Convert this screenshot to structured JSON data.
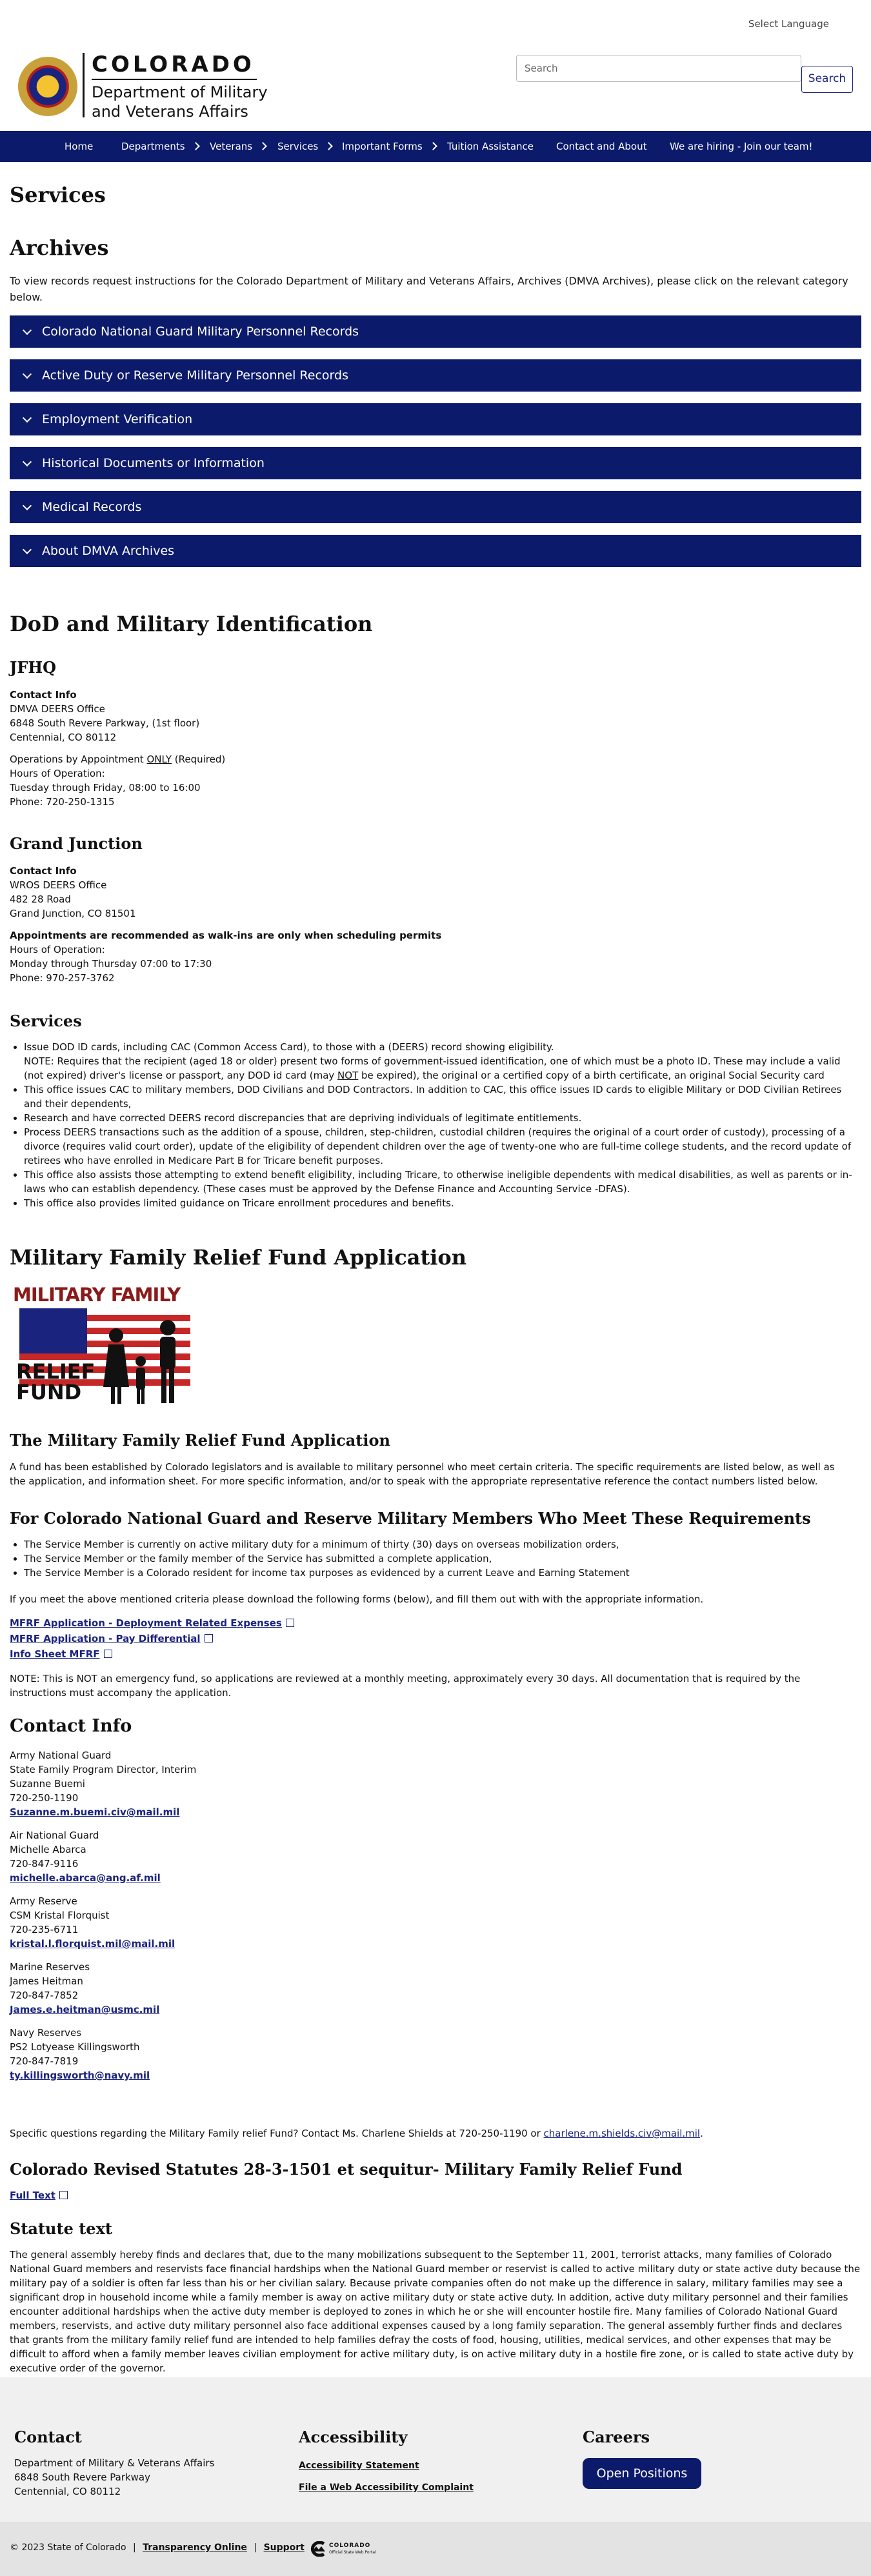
{
  "topbar": {
    "language": "Select Language"
  },
  "header": {
    "brand_line1": "COLORADO",
    "brand_line2": "Department of Military",
    "brand_line3": "and Veterans Affairs",
    "search_placeholder": "Search",
    "search_button": "Search"
  },
  "nav": {
    "items": [
      {
        "label": "Home"
      },
      {
        "label": "Departments"
      },
      {
        "label": "Veterans"
      },
      {
        "label": "Services"
      },
      {
        "label": "Important Forms"
      },
      {
        "label": "Tuition Assistance"
      },
      {
        "label": "Contact and About"
      },
      {
        "label": "We are hiring - Join our team!"
      }
    ]
  },
  "page_title": "Services",
  "archives": {
    "title": "Archives",
    "intro": "To view records request instructions for the Colorado Department of Military and Veterans Affairs, Archives (DMVA Archives), please click on the relevant category below.",
    "accordion": [
      "Colorado National Guard Military Personnel Records",
      "Active Duty or Reserve Military Personnel Records",
      "Employment Verification",
      "Historical Documents or Information",
      "Medical Records",
      "About DMVA Archives"
    ]
  },
  "dod": {
    "title": "DoD and Military Identification",
    "jfhq": {
      "title": "JFHQ",
      "contact_label": "Contact Info",
      "lines": [
        "DMVA DEERS Office",
        "6848 South Revere Parkway, (1st floor)",
        "Centennial, CO 80112"
      ],
      "ops_prefix": "Operations by Appointment ",
      "ops_only": "ONLY",
      "ops_suffix": " (Required)",
      "hours_label": "Hours of Operation:",
      "hours": "Tuesday through Friday, 08:00 to 16:00",
      "phone": "Phone: 720-250-1315"
    },
    "gj": {
      "title": "Grand Junction",
      "contact_label": "Contact Info",
      "lines": [
        "WROS DEERS Office",
        "482 28 Road",
        "Grand Junction, CO 81501"
      ],
      "note": "Appointments are recommended as walk-ins are only when scheduling permits",
      "hours_label": "Hours of Operation:",
      "hours": "Monday through Thursday 07:00 to 17:30",
      "phone": "Phone: 970-257-3762"
    },
    "services": {
      "title": "Services",
      "item1": "Issue DOD ID cards, including CAC (Common Access Card), to those with a (DEERS) record showing eligibility.",
      "item1_note_a": "NOTE: Requires that the recipient (aged 18 or older) present two forms of government-issued identification, one of which must be a photo ID. These may include a valid (not expired) driver's license or passport, any DOD id card (may ",
      "item1_note_not": "NOT",
      "item1_note_b": " be expired), the original or a certified copy of a birth certificate, an original Social Security card",
      "items": [
        "This office issues CAC to military members, DOD Civilians and DOD Contractors. In addition to CAC, this office issues ID cards to eligible Military or DOD Civilian Retirees and their dependents,",
        "Research and have corrected DEERS record discrepancies that are depriving individuals of legitimate entitlements.",
        "Process DEERS transactions such as the addition of a spouse, children, step-children, custodial children (requires the original of a court order of custody), processing of a divorce (requires valid court order), update of the eligibility of dependent children over the age of twenty-one who are full-time college students, and the record update of retirees who have enrolled in Medicare Part B for Tricare benefit purposes.",
        "This office also assists those attempting to extend benefit eligibility, including Tricare, to otherwise ineligible dependents with medical disabilities, as well as parents or in-laws who can establish dependency. (These cases must be approved by the Defense Finance and Accounting Service -DFAS).",
        "This office also provides limited guidance on Tricare enrollment procedures and benefits."
      ]
    }
  },
  "mfrf": {
    "title": "Military Family Relief Fund Application",
    "logo_top": "MILITARY FAMILY",
    "logo_bottom1": "RELIEF",
    "logo_bottom2": "FUND",
    "subtitle": "The Military Family Relief Fund Application",
    "intro": "A fund has been established by Colorado legislators and is available to military personnel who meet certain criteria. The specific requirements are listed below, as well as the application, and information sheet. For more specific information, and/or to speak with the appropriate representative reference the contact numbers listed below.",
    "req_title": "For Colorado National Guard and Reserve Military Members Who Meet These Requirements",
    "reqs": [
      "The Service Member is currently on active military duty for a minimum of thirty (30) days on overseas mobilization orders,",
      "The Service Member or the family member of the Service has submitted a complete application,",
      "The Service Member is a Colorado resident for income tax purposes as evidenced by a current Leave and Earning Statement"
    ],
    "download_text": "If you meet the above mentioned criteria please download the following forms (below), and fill them out with with the appropriate information.",
    "links": [
      "MFRF Application - Deployment Related Expenses",
      "MFRF Application - Pay Differential",
      "Info Sheet MFRF"
    ],
    "note": "NOTE: This is NOT an emergency fund, so applications are reviewed at a monthly meeting, approximately every 30 days. All documentation that is required by the instructions must accompany the application."
  },
  "contact": {
    "title": "Contact Info",
    "groups": [
      {
        "lines": [
          "Army National Guard",
          "State Family Program Director, Interim",
          "Suzanne Buemi",
          "720-250-1190"
        ],
        "email": "Suzanne.m.buemi.civ@mail.mil"
      },
      {
        "lines": [
          "Air National Guard",
          "Michelle Abarca",
          "720-847-9116"
        ],
        "email": "michelle.abarca@ang.af.mil"
      },
      {
        "lines": [
          "Army Reserve",
          "CSM Kristal Florquist",
          "720-235-6711"
        ],
        "email": "kristal.l.florquist.mil@mail.mil"
      },
      {
        "lines": [
          "Marine Reserves",
          "James Heitman",
          "720-847-7852"
        ],
        "email": "James.e.heitman@usmc.mil"
      },
      {
        "lines": [
          "Navy Reserves",
          "PS2 Lotyease Killingsworth",
          "720-847-7819"
        ],
        "email": "ty.killingsworth@navy.mil"
      }
    ],
    "questions_prefix": "Specific questions regarding the Military Family relief Fund? Contact Ms. Charlene Shields at 720-250-1190 or ",
    "questions_email": "charlene.m.shields.civ@mail.mil",
    "questions_suffix": "."
  },
  "statutes": {
    "title": "Colorado Revised Statutes 28-3-1501 et sequitur- Military Family Relief Fund",
    "full_text_link": "Full Text",
    "statute_title": "Statute text",
    "statute_body": "The general assembly hereby finds and declares that, due to the many mobilizations subsequent to the September 11, 2001, terrorist attacks, many families of Colorado National Guard members and reservists face financial hardships when the National Guard member or reservist is called to active military duty or state active duty because the military pay of a soldier is often far less than his or her civilian salary. Because private companies often do not make up the difference in salary, military families may see a significant drop in household income while a family member is away on active military duty or state active duty. In addition, active duty military personnel and their families encounter additional hardships when the active duty member is deployed to zones in which he or she will encounter hostile fire. Many families of Colorado National Guard members, reservists, and active duty military personnel also face additional expenses caused by a long family separation. The general assembly further finds and declares that grants from the military family relief fund are intended to help families defray the costs of food, housing, utilities, medical services, and other expenses that may be difficult to afford when a family member leaves civilian employment for active military duty, is on active military duty in a hostile fire zone, or is called to state active duty by executive order of the governor."
  },
  "footer": {
    "contact_title": "Contact",
    "contact_lines": [
      "Department of Military & Veterans Affairs",
      "6848 South Revere Parkway",
      "Centennial, CO 80112"
    ],
    "access_title": "Accessibility",
    "access_links": [
      "Accessibility Statement",
      "File a Web Accessibility Complaint"
    ],
    "careers_title": "Careers",
    "careers_button": "Open Positions",
    "copyright": "© 2023 State of Colorado",
    "sep": "|",
    "transparency": "Transparency Online",
    "support": "Support",
    "portal_name": "COLORADO",
    "portal_tag": "Official State Web Portal"
  }
}
